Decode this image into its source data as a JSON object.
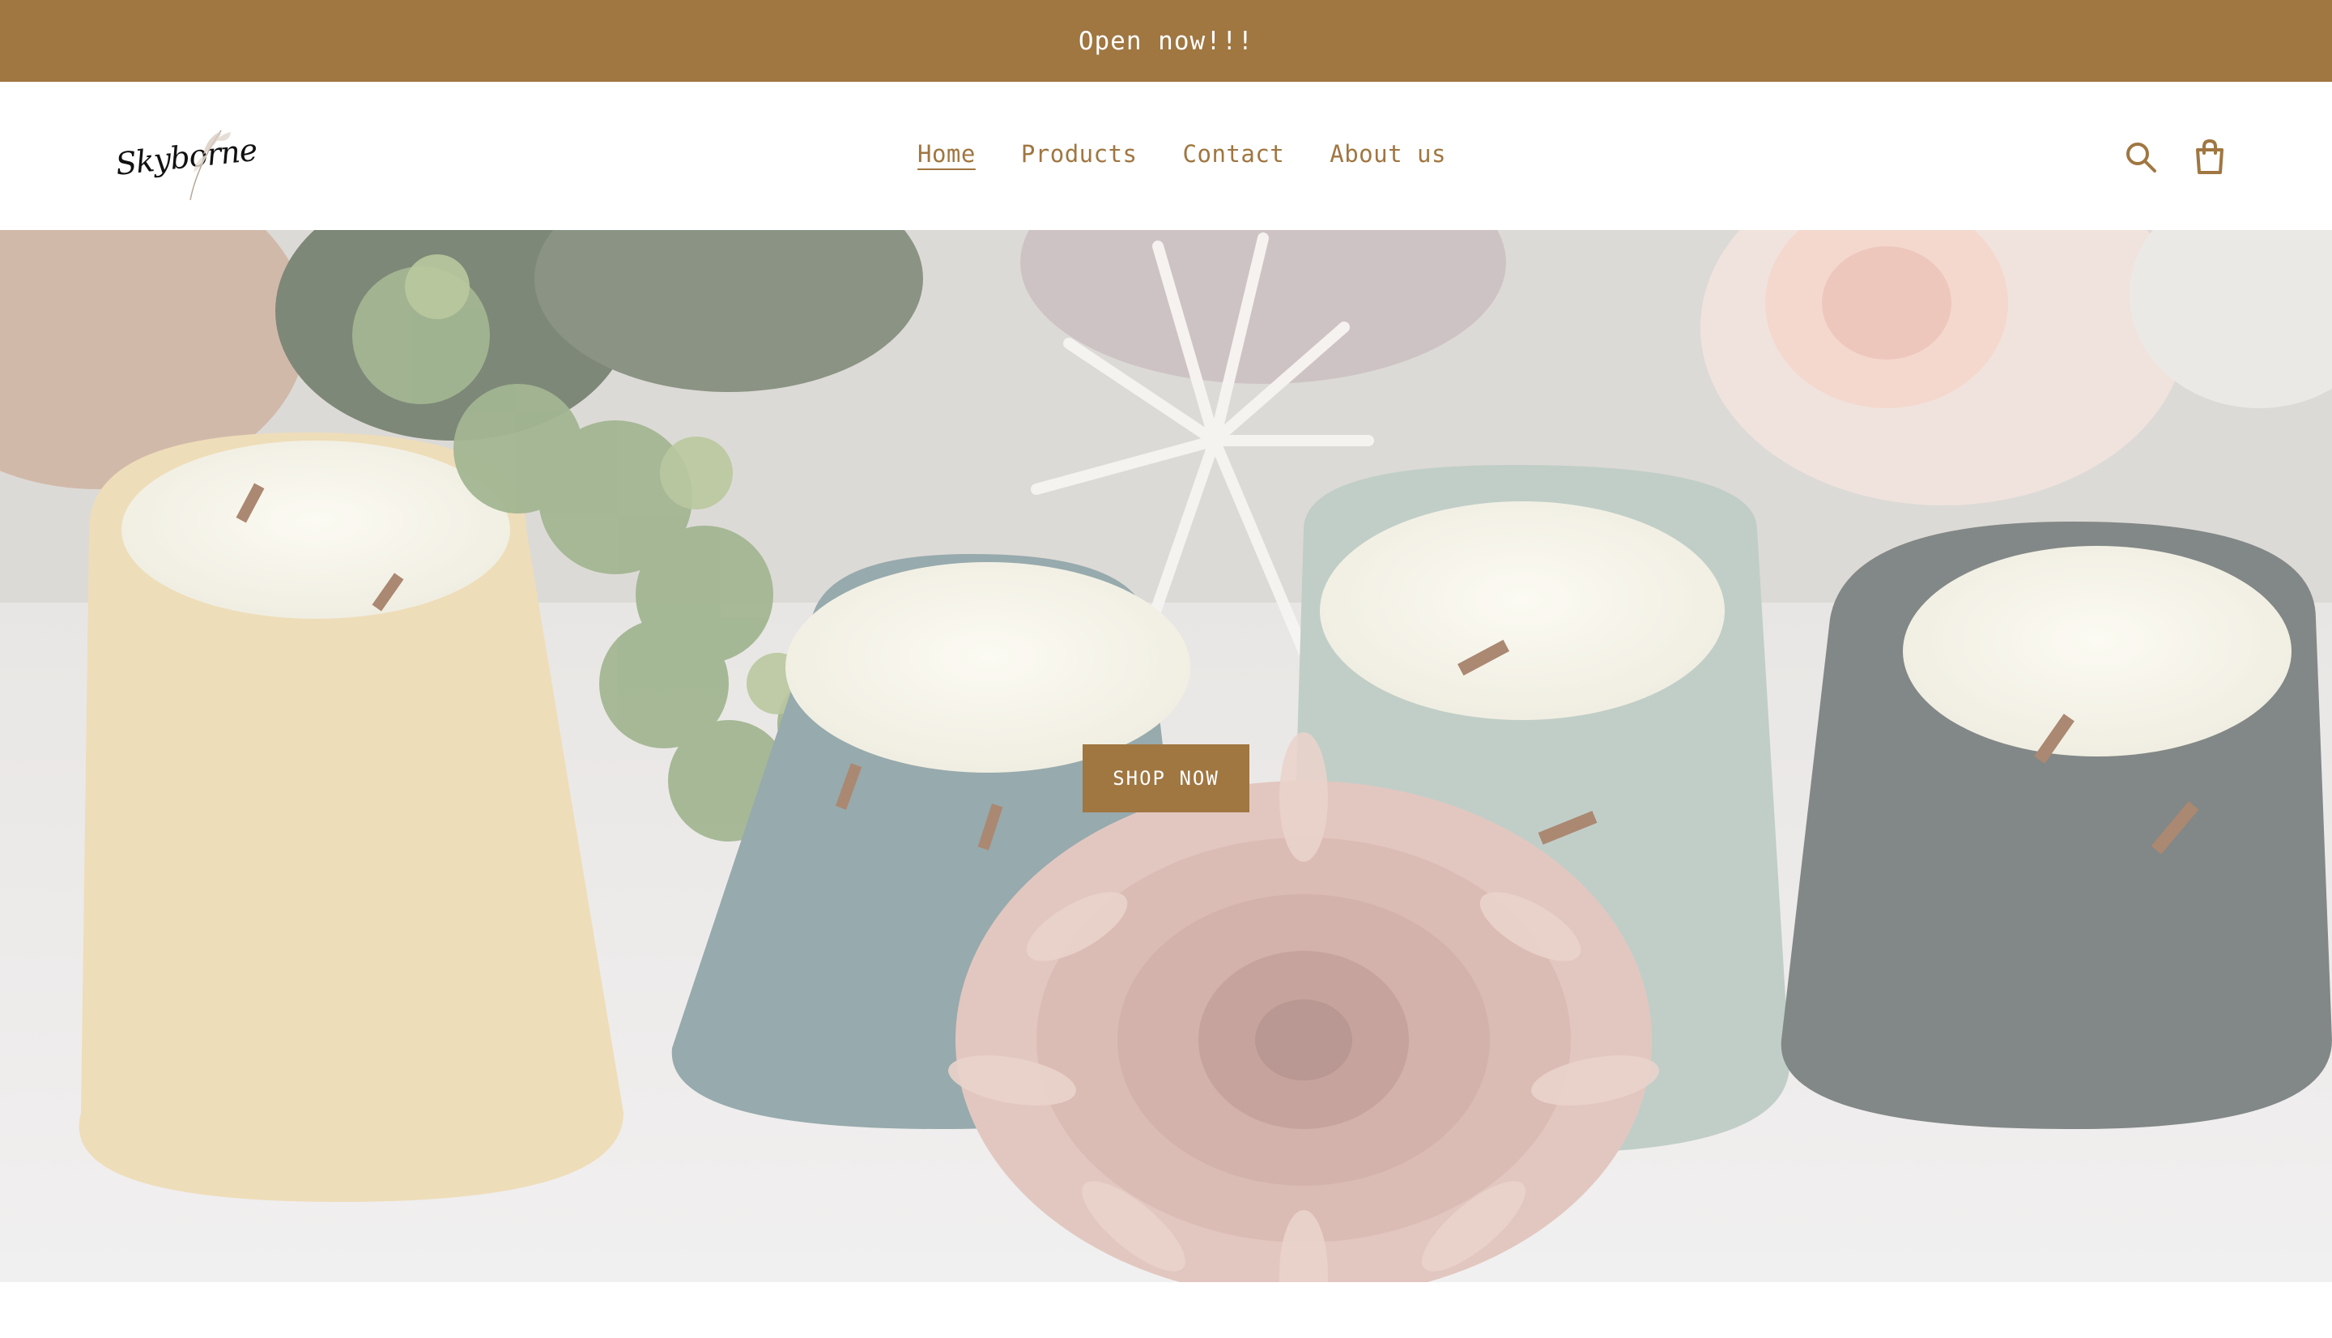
{
  "announcement": {
    "text": "Open now!!!"
  },
  "header": {
    "logo_text": "Skyborne",
    "nav": [
      {
        "label": "Home",
        "active": true
      },
      {
        "label": "Products",
        "active": false
      },
      {
        "label": "Contact",
        "active": false
      },
      {
        "label": "About us",
        "active": false
      }
    ],
    "icons": [
      "search-icon",
      "cart-icon"
    ]
  },
  "hero": {
    "image": "candles-with-flowers",
    "cta_label": "SHOP NOW"
  },
  "colors": {
    "accent": "#a07641",
    "announcement_text": "#ffffff",
    "background": "#ffffff"
  }
}
